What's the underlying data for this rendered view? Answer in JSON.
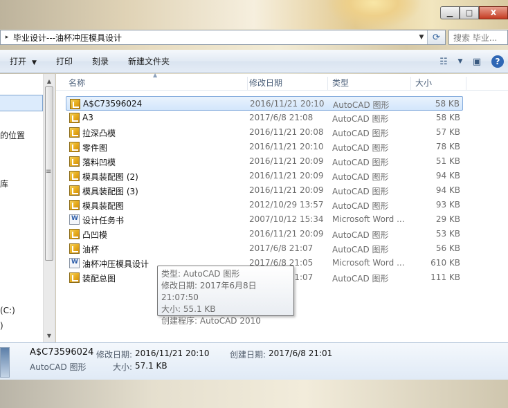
{
  "window": {
    "min_label": "▁",
    "max_label": "□",
    "close_label": "X"
  },
  "address": {
    "breadcrumb_arrow": "▸",
    "path": "毕业设计---油杯冲压模具设计",
    "search_placeholder": "搜索 毕业..."
  },
  "toolbar": {
    "open_label": "打开",
    "print_label": "打印",
    "burn_label": "刻录",
    "new_folder_label": "新建文件夹"
  },
  "nav": {
    "items": [
      "的位置",
      "库",
      "(C:)",
      ")"
    ]
  },
  "columns": {
    "name": "名称",
    "date": "修改日期",
    "type": "类型",
    "size": "大小"
  },
  "files": [
    {
      "name": "A$C73596024",
      "date": "2016/11/21 20:10",
      "type": "AutoCAD 图形",
      "size": "58 KB",
      "icon": "autocad-file-icon",
      "selected": true
    },
    {
      "name": "A3",
      "date": "2017/6/8 21:08",
      "type": "AutoCAD 图形",
      "size": "58 KB",
      "icon": "autocad-file-icon"
    },
    {
      "name": "拉深凸模",
      "date": "2016/11/21 20:08",
      "type": "AutoCAD 图形",
      "size": "57 KB",
      "icon": "autocad-file-icon"
    },
    {
      "name": "零件图",
      "date": "2016/11/21 20:10",
      "type": "AutoCAD 图形",
      "size": "78 KB",
      "icon": "autocad-file-icon"
    },
    {
      "name": "落料凹模",
      "date": "2016/11/21 20:09",
      "type": "AutoCAD 图形",
      "size": "51 KB",
      "icon": "autocad-file-icon"
    },
    {
      "name": "模具装配图 (2)",
      "date": "2016/11/21 20:09",
      "type": "AutoCAD 图形",
      "size": "94 KB",
      "icon": "autocad-file-icon"
    },
    {
      "name": "模具装配图 (3)",
      "date": "2016/11/21 20:09",
      "type": "AutoCAD 图形",
      "size": "94 KB",
      "icon": "autocad-file-icon"
    },
    {
      "name": "模具装配图",
      "date": "2012/10/29 13:57",
      "type": "AutoCAD 图形",
      "size": "93 KB",
      "icon": "autocad-file-icon"
    },
    {
      "name": "设计任务书",
      "date": "2007/10/12 15:34",
      "type": "Microsoft Word ...",
      "size": "29 KB",
      "icon": "word-file-icon"
    },
    {
      "name": "凸凹模",
      "date": "2016/11/21 20:09",
      "type": "AutoCAD 图形",
      "size": "53 KB",
      "icon": "autocad-file-icon"
    },
    {
      "name": "油杯",
      "date": "2017/6/8 21:07",
      "type": "AutoCAD 图形",
      "size": "56 KB",
      "icon": "autocad-file-icon"
    },
    {
      "name": "油杯冲压模具设计",
      "date": "2017/6/8 21:05",
      "type": "Microsoft Word ...",
      "size": "610 KB",
      "icon": "word-file-icon"
    },
    {
      "name": "装配总图",
      "date": "2017/6/8 21:07",
      "type": "AutoCAD 图形",
      "size": "111 KB",
      "icon": "autocad-file-icon"
    }
  ],
  "tooltip": {
    "type_line": "类型: AutoCAD 图形",
    "modified_line": "修改日期: 2017年6月8日 21:07:50",
    "size_line": "大小: 55.1 KB",
    "program_line": "创建程序: AutoCAD 2010"
  },
  "details": {
    "filename": "A$C73596024",
    "modified_label": "修改日期:",
    "modified_value": "2016/11/21 20:10",
    "created_label": "创建日期:",
    "created_value": "2017/6/8 21:01",
    "type": "AutoCAD 图形",
    "size_label": "大小:",
    "size_value": "57.1 KB"
  }
}
